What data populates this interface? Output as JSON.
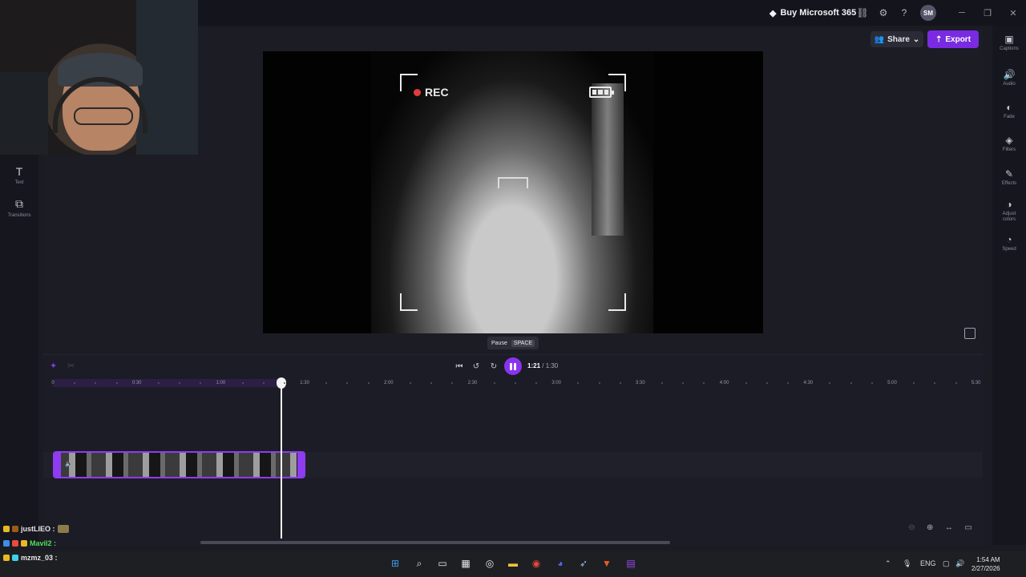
{
  "titlebar": {
    "buy_label": "Buy Microsoft 365",
    "avatar_initials": "SM",
    "help_glyph": "?",
    "icons": [
      "diamond-icon",
      "link-icon",
      "gear-icon",
      "help-icon"
    ]
  },
  "left_rail": {
    "items": [
      {
        "label": "Text",
        "icon": "text-icon"
      },
      {
        "label": "Transitions",
        "icon": "transitions-icon"
      }
    ]
  },
  "right_rail": {
    "items": [
      {
        "label": "Captions",
        "icon": "captions-icon"
      },
      {
        "label": "Audio",
        "icon": "audio-icon"
      },
      {
        "label": "Fade",
        "icon": "fade-icon"
      },
      {
        "label": "Filters",
        "icon": "filters-icon"
      },
      {
        "label": "Effects",
        "icon": "effects-icon"
      },
      {
        "label": "Adjust colors",
        "icon": "adjust-colors-icon"
      },
      {
        "label": "Speed",
        "icon": "speed-icon"
      }
    ]
  },
  "actions": {
    "share_label": "Share",
    "export_label": "Export"
  },
  "preview": {
    "rec_label": "REC",
    "tooltip_label": "Pause",
    "tooltip_key": "SPACE"
  },
  "playback": {
    "current_time": "1:21",
    "separator": " / ",
    "total_time": "1:30"
  },
  "ruler": {
    "labels": [
      "0",
      "0:30",
      "1:00",
      "1:30",
      "2:00",
      "2:30",
      "3:00",
      "3:30",
      "4:00",
      "4:30",
      "5:00",
      "5:30"
    ]
  },
  "chat": {
    "messages": [
      {
        "user": "justLIEO :",
        "color": "#e8e8e8"
      },
      {
        "user": "Mavil2 :",
        "color": "#4fe05a"
      },
      {
        "user": "mzmz_03 :",
        "color": "#e8e8e8"
      }
    ]
  },
  "tray": {
    "language": "ENG",
    "time": "1:54 AM",
    "date": "2/27/2026"
  },
  "colors": {
    "accent": "#8a33ef",
    "export": "#7a2be2",
    "rec": "#e23c3c"
  }
}
